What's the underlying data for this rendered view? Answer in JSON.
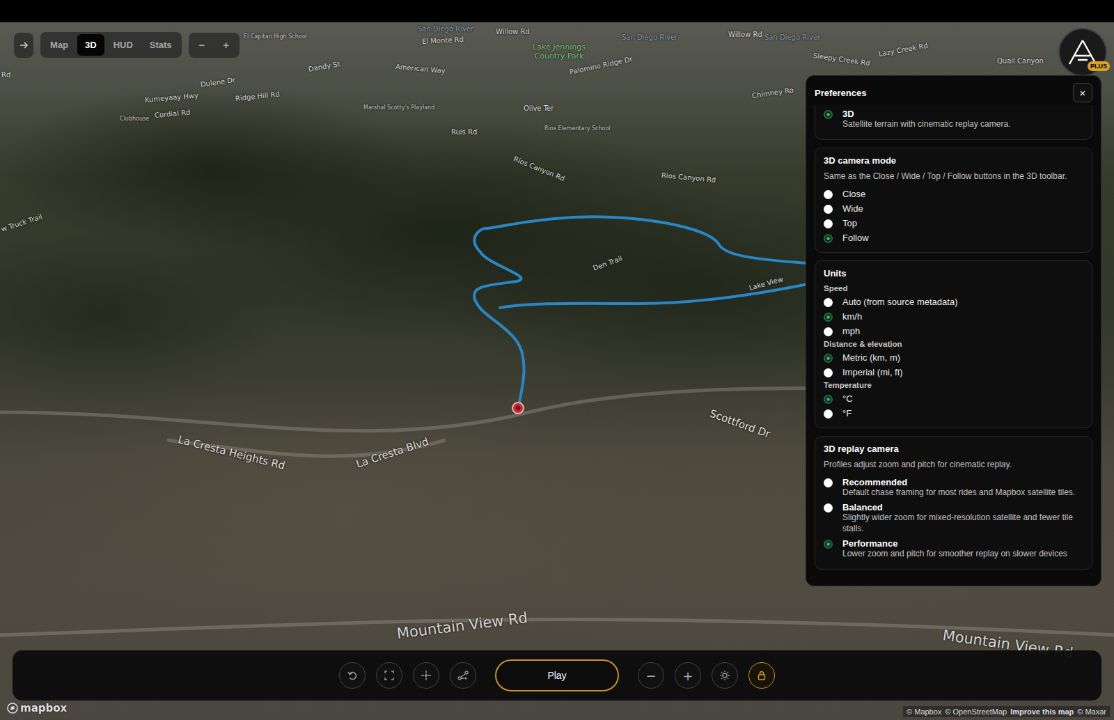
{
  "toolbar": {
    "view_tabs": [
      {
        "label": "Map",
        "selected": false
      },
      {
        "label": "3D",
        "selected": true
      },
      {
        "label": "HUD",
        "selected": false
      },
      {
        "label": "Stats",
        "selected": false
      }
    ],
    "zoom_buttons": [
      "−",
      "+"
    ]
  },
  "logo": {
    "badge": "PLUS"
  },
  "map": {
    "labels": [
      {
        "text": "Rd",
        "kind": "road"
      },
      {
        "text": "Clubhouse",
        "kind": "poi"
      },
      {
        "text": "Kumeyaay Hwy",
        "kind": "road"
      },
      {
        "text": "Cordial Rd",
        "kind": "road"
      },
      {
        "text": "Dulene Dr",
        "kind": "road"
      },
      {
        "text": "Ridge Hill Rd",
        "kind": "road"
      },
      {
        "text": "Dandy St",
        "kind": "road"
      },
      {
        "text": "El Capitan High School",
        "kind": "poi"
      },
      {
        "text": "American Way",
        "kind": "road"
      },
      {
        "text": "El Monte Rd",
        "kind": "road"
      },
      {
        "text": "San Diego River",
        "kind": "water"
      },
      {
        "text": "Willow Rd",
        "kind": "road"
      },
      {
        "text": "Lake Jennings Country Park",
        "kind": "park"
      },
      {
        "text": "Marshal Scotty's Playland",
        "kind": "poi"
      },
      {
        "text": "Olive Ter",
        "kind": "road"
      },
      {
        "text": "Ruis Rd",
        "kind": "road"
      },
      {
        "text": "Rios Elementary School",
        "kind": "poi"
      },
      {
        "text": "Palomino Ridge Dr",
        "kind": "road"
      },
      {
        "text": "Rios Canyon Rd",
        "kind": "road"
      },
      {
        "text": "Rios Canyon Rd",
        "kind": "road"
      },
      {
        "text": "San Diego River",
        "kind": "water"
      },
      {
        "text": "Willow Rd",
        "kind": "road"
      },
      {
        "text": "San Diego River",
        "kind": "water"
      },
      {
        "text": "Sleepy Creek Rd",
        "kind": "road"
      },
      {
        "text": "Lazy Creek Rd",
        "kind": "road"
      },
      {
        "text": "Quail Canyon",
        "kind": "road"
      },
      {
        "text": "Chimney Ro",
        "kind": "road"
      },
      {
        "text": "w Truck Trail",
        "kind": "road"
      },
      {
        "text": "Den Trail",
        "kind": "road"
      },
      {
        "text": "Lake View",
        "kind": "road"
      },
      {
        "text": "La Cresta Heights Rd",
        "kind": "street"
      },
      {
        "text": "La Cresta Blvd",
        "kind": "street"
      },
      {
        "text": "Scottford Dr",
        "kind": "street"
      },
      {
        "text": "Mountain View Rd",
        "kind": "major"
      },
      {
        "text": "Mountain View Rd",
        "kind": "major"
      }
    ],
    "brand": "mapbox",
    "attribution": [
      {
        "text": "© Mapbox",
        "bold": false
      },
      {
        "text": "© OpenStreetMap",
        "bold": false
      },
      {
        "text": "Improve this map",
        "bold": true
      },
      {
        "text": "© Maxar",
        "bold": false
      }
    ]
  },
  "preferences": {
    "title": "Preferences",
    "close": "×",
    "sections": [
      {
        "title": "",
        "description": "",
        "groups": [
          {
            "label": "",
            "options": [
              {
                "label": "3D",
                "description": "Satellite terrain with cinematic replay camera.",
                "selected": true
              }
            ]
          }
        ]
      },
      {
        "title": "3D camera mode",
        "description": "Same as the Close / Wide / Top / Follow buttons in the 3D toolbar.",
        "groups": [
          {
            "label": "",
            "options": [
              {
                "label": "Close",
                "description": "",
                "selected": false
              },
              {
                "label": "Wide",
                "description": "",
                "selected": false
              },
              {
                "label": "Top",
                "description": "",
                "selected": false
              },
              {
                "label": "Follow",
                "description": "",
                "selected": true
              }
            ]
          }
        ]
      },
      {
        "title": "Units",
        "description": "",
        "groups": [
          {
            "label": "Speed",
            "options": [
              {
                "label": "Auto (from source metadata)",
                "description": "",
                "selected": false
              },
              {
                "label": "km/h",
                "description": "",
                "selected": true
              },
              {
                "label": "mph",
                "description": "",
                "selected": false
              }
            ]
          },
          {
            "label": "Distance & elevation",
            "options": [
              {
                "label": "Metric (km, m)",
                "description": "",
                "selected": true
              },
              {
                "label": "Imperial (mi, ft)",
                "description": "",
                "selected": false
              }
            ]
          },
          {
            "label": "Temperature",
            "options": [
              {
                "label": "°C",
                "description": "",
                "selected": true
              },
              {
                "label": "°F",
                "description": "",
                "selected": false
              }
            ]
          }
        ]
      },
      {
        "title": "3D replay camera",
        "description": "Profiles adjust zoom and pitch for cinematic replay.",
        "groups": [
          {
            "label": "",
            "options": [
              {
                "label": "Recommended",
                "description": "Default chase framing for most rides and Mapbox satellite tiles.",
                "selected": false
              },
              {
                "label": "Balanced",
                "description": "Slightly wider zoom for mixed-resolution satellite and fewer tile stalls.",
                "selected": false
              },
              {
                "label": "Performance",
                "description": "Lower zoom and pitch for smoother replay on slower devices",
                "selected": true
              }
            ]
          }
        ]
      }
    ]
  },
  "playback": {
    "play": "Play",
    "zoom_buttons": [
      "−",
      "+"
    ],
    "locked": true
  }
}
